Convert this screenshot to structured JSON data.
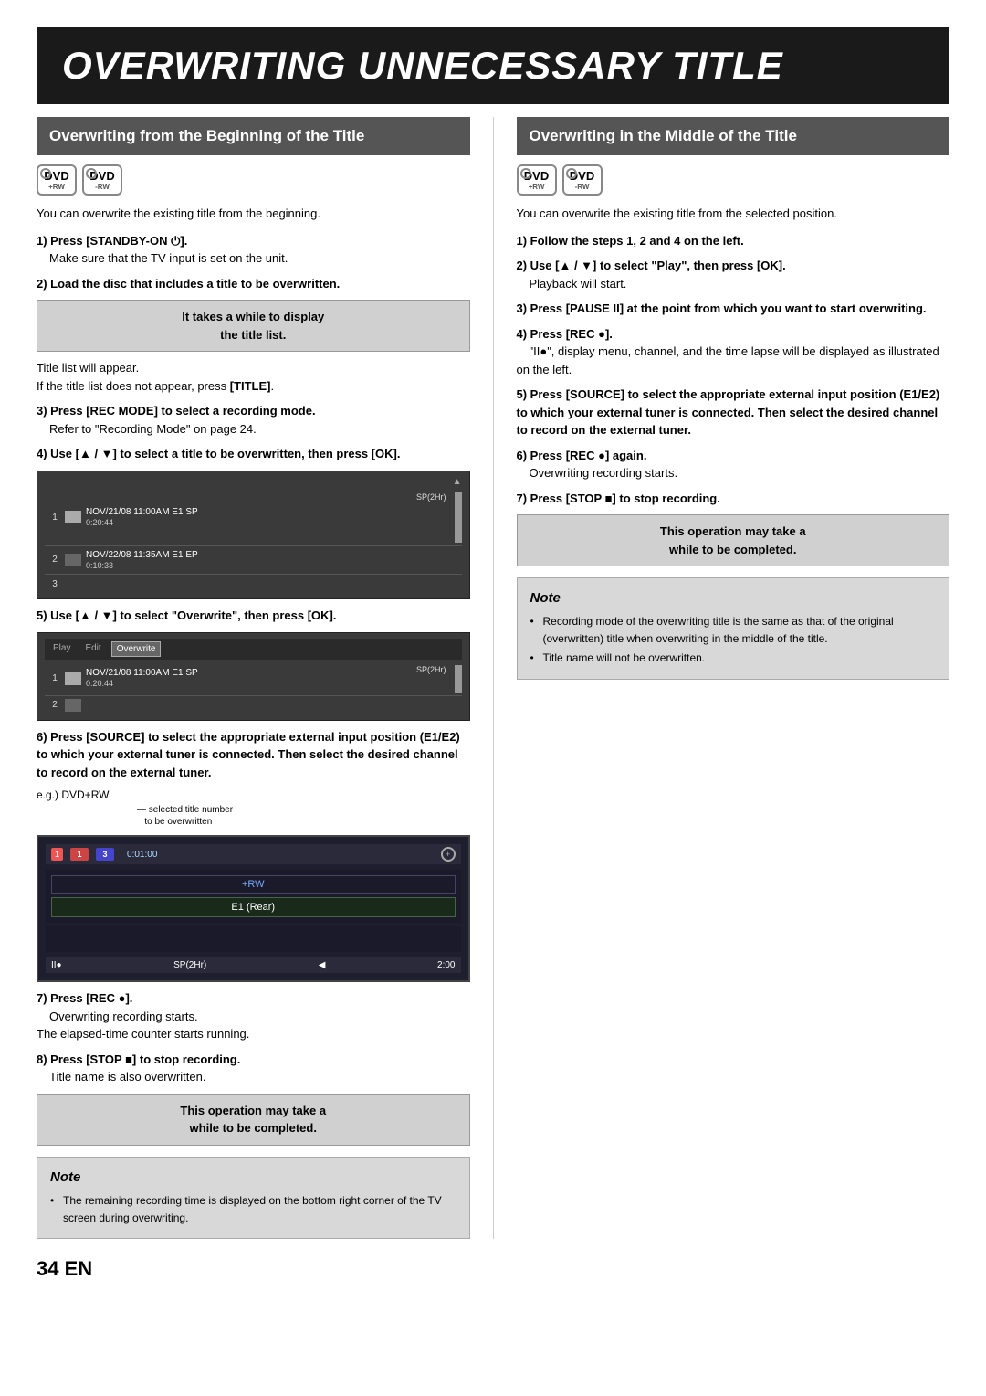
{
  "page": {
    "main_title": "OVERWRITING UNNECESSARY TITLE",
    "page_number": "34 EN",
    "left_section": {
      "heading": "Overwriting from the Beginning of the Title",
      "dvd_icons": [
        {
          "label": "DVD",
          "sub": "+RW"
        },
        {
          "label": "DVD",
          "sub": "-RW"
        }
      ],
      "intro": "You can overwrite the existing title from the beginning.",
      "steps": [
        {
          "id": "step1",
          "title": "1) Press [STANDBY-ON ⏻].",
          "body": "Make sure that the TV input is set on the unit."
        },
        {
          "id": "step2",
          "title": "2) Load the disc that includes a title to be overwritten.",
          "body": ""
        },
        {
          "id": "callout1",
          "type": "callout",
          "text": "It takes a while to display\nthe title list."
        },
        {
          "id": "step2b",
          "title": "",
          "body": "Title list will appear.\nIf the title list does not appear, press [TITLE]."
        },
        {
          "id": "step3",
          "title": "3) Press [REC MODE] to select a recording mode.",
          "body": "Refer to \"Recording Mode\" on page 24."
        },
        {
          "id": "step4",
          "title": "4) Use [▲ / ▼] to select a title to be overwritten, then press [OK].",
          "body": ""
        },
        {
          "id": "step5",
          "title": "5) Use [▲ / ▼] to select \"Overwrite\", then press [OK].",
          "body": ""
        },
        {
          "id": "step6",
          "title": "6) Press [SOURCE] to select the appropriate external input position (E1/E2) to which your external tuner is connected. Then select the desired channel to record on the external tuner.",
          "body": ""
        },
        {
          "id": "eg_label",
          "text": "e.g.) DVD+RW"
        },
        {
          "id": "diagram_label",
          "text": "selected title number\nto be overwritten"
        },
        {
          "id": "step7",
          "title": "7) Press [REC ●].",
          "body": "Overwriting recording starts.\nThe elapsed-time counter starts running."
        },
        {
          "id": "step8",
          "title": "8) Press [STOP ■] to stop recording.",
          "body": "Title name is also overwritten."
        },
        {
          "id": "callout2",
          "type": "callout",
          "text": "This operation may take a\nwhile to be completed."
        }
      ],
      "note": {
        "title": "Note",
        "items": [
          "The remaining recording time is displayed on the bottom right corner of the TV screen during overwriting."
        ]
      }
    },
    "right_section": {
      "heading": "Overwriting in the Middle of the Title",
      "dvd_icons": [
        {
          "label": "DVD",
          "sub": "+RW"
        },
        {
          "label": "DVD",
          "sub": "-RW"
        }
      ],
      "intro": "You can overwrite the existing title from the selected position.",
      "steps": [
        {
          "id": "r_step1",
          "title": "1) Follow the steps 1, 2 and 4 on the left.",
          "body": ""
        },
        {
          "id": "r_step2",
          "title": "2) Use [▲ / ▼] to select \"Play\", then press [OK].",
          "body": "Playback will start."
        },
        {
          "id": "r_step3",
          "title": "3) Press [PAUSE II] at the point from which you want to start overwriting.",
          "body": ""
        },
        {
          "id": "r_step4",
          "title": "4) Press [REC ●].",
          "body": "\"II●\", display menu, channel, and the time lapse will be displayed as illustrated on the left."
        },
        {
          "id": "r_step5",
          "title": "5) Press [SOURCE] to select the appropriate external input position (E1/E2) to which your external tuner is connected. Then select the desired channel to record on the external tuner.",
          "body": ""
        },
        {
          "id": "r_step6",
          "title": "6) Press [REC ●] again.",
          "body": "Overwriting recording starts."
        },
        {
          "id": "r_step7",
          "title": "7) Press [STOP ■] to stop recording.",
          "body": ""
        },
        {
          "id": "r_callout",
          "type": "callout",
          "text": "This operation may take a\nwhile to be completed."
        }
      ],
      "note": {
        "title": "Note",
        "items": [
          "Recording mode of the overwriting title is the same as that of the original (overwritten) title when overwriting in the middle of the title.",
          "Title name will not be overwritten."
        ]
      }
    },
    "screen1": {
      "rows": [
        {
          "num": "1",
          "bar": true,
          "selected": false,
          "date": "NOV/21/08 11:00AM E1 SP",
          "duration": "0:20:44",
          "quality": "SP(2Hr)"
        },
        {
          "num": "2",
          "bar": true,
          "selected": false,
          "date": "NOV/22/08 11:35AM E1 EP",
          "duration": "0:10:33",
          "quality": ""
        },
        {
          "num": "3",
          "bar": false,
          "selected": false,
          "date": "",
          "duration": "",
          "quality": ""
        }
      ]
    },
    "screen2": {
      "menu_items": [
        "Play",
        "Edit",
        "Overwrite"
      ],
      "active_item": "Overwrite",
      "row": {
        "num": "1",
        "date": "NOV/21/08 11:00AM E1 SP",
        "duration": "0:20:44",
        "quality": "SP(2Hr)"
      }
    },
    "tvscreen": {
      "buttons": [
        "1",
        "1",
        "3"
      ],
      "time": "0:01:00",
      "channel_label": "+RW",
      "input_label": "E1 (Rear)",
      "status_left": "II●",
      "status_right": "SP(2Hr)",
      "status_time": "2:00"
    }
  }
}
